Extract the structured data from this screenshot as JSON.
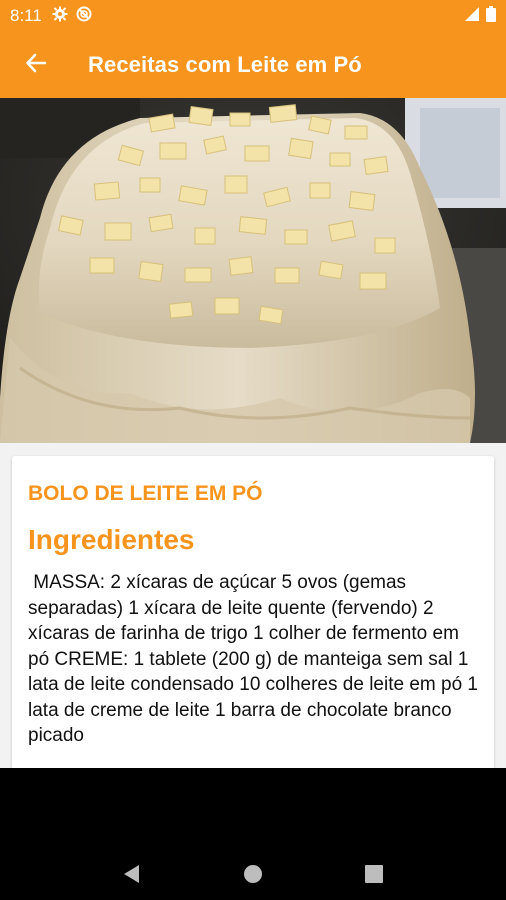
{
  "status_bar": {
    "time": "8:11",
    "icons_left": [
      "gear-icon",
      "no-sync-icon"
    ],
    "icons_right": [
      "signal-icon",
      "battery-icon"
    ]
  },
  "app_bar": {
    "title": "Receitas com Leite em Pó",
    "back_icon": "arrow-back-icon",
    "background_color": "#f7941d"
  },
  "hero_image": {
    "subject": "cake with white frosting and chopped white chocolate"
  },
  "card": {
    "recipe_title": "BOLO DE LEITE EM PÓ",
    "section_title": "Ingredientes",
    "ingredients_text": " MASSA: 2 xícaras de açúcar 5 ovos (gemas separadas) 1 xícara de leite quente (fervendo) 2 xícaras de farinha de trigo 1 colher de fermento em pó CREME: 1 tablete (200 g) de manteiga sem sal 1 lata de leite condensado 10 colheres de leite em pó 1 lata de creme de leite 1 barra de chocolate branco picado",
    "accent_color": "#f7941d"
  },
  "nav_bar": {
    "buttons": [
      "back-triangle-icon",
      "home-circle-icon",
      "recents-square-icon"
    ]
  }
}
